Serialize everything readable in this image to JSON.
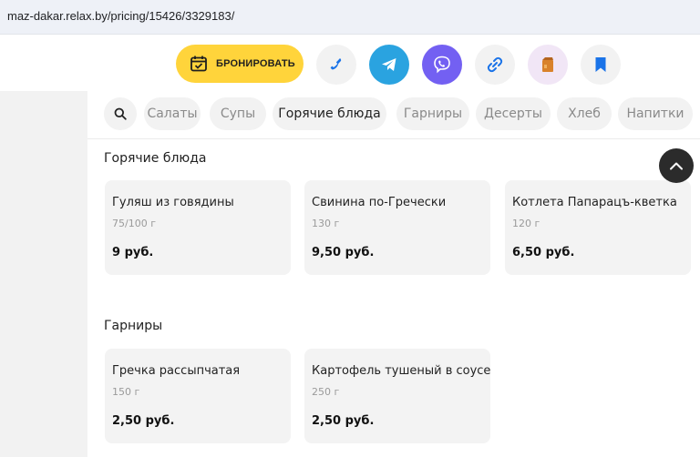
{
  "browser": {
    "url": "maz-dakar.relax.by/pricing/15426/3329183/"
  },
  "toolbar": {
    "book_label": "БРОНИРОВАТЬ",
    "icons": [
      "calendar-check-icon",
      "phone-icon",
      "telegram-icon",
      "viber-icon",
      "link-icon",
      "bag-icon",
      "bookmark-icon"
    ],
    "colors": {
      "book": "#ffd43b",
      "telegram": "#2aa3e0",
      "viber": "#7360f2",
      "accent": "#1a73e8"
    }
  },
  "categories": [
    "Салаты",
    "Супы",
    "Горячие блюда",
    "Гарниры",
    "Десерты",
    "Хлеб",
    "Напитки"
  ],
  "active_category": "Горячие блюда",
  "sections": [
    {
      "title": "Горячие блюда",
      "items": [
        {
          "name": "Гуляш из говядины",
          "weight": "75/100 г",
          "price": "9 руб."
        },
        {
          "name": "Свинина по-Гречески",
          "weight": "130 г",
          "price": "9,50 руб."
        },
        {
          "name": "Котлета Папарацъ-кветка",
          "weight": "120 г",
          "price": "6,50 руб."
        }
      ]
    },
    {
      "title": "Гарниры",
      "items": [
        {
          "name": "Гречка рассыпчатая",
          "weight": "150 г",
          "price": "2,50 руб."
        },
        {
          "name": "Картофель тушеный в соусе",
          "weight": "250 г",
          "price": "2,50 руб."
        }
      ]
    }
  ]
}
